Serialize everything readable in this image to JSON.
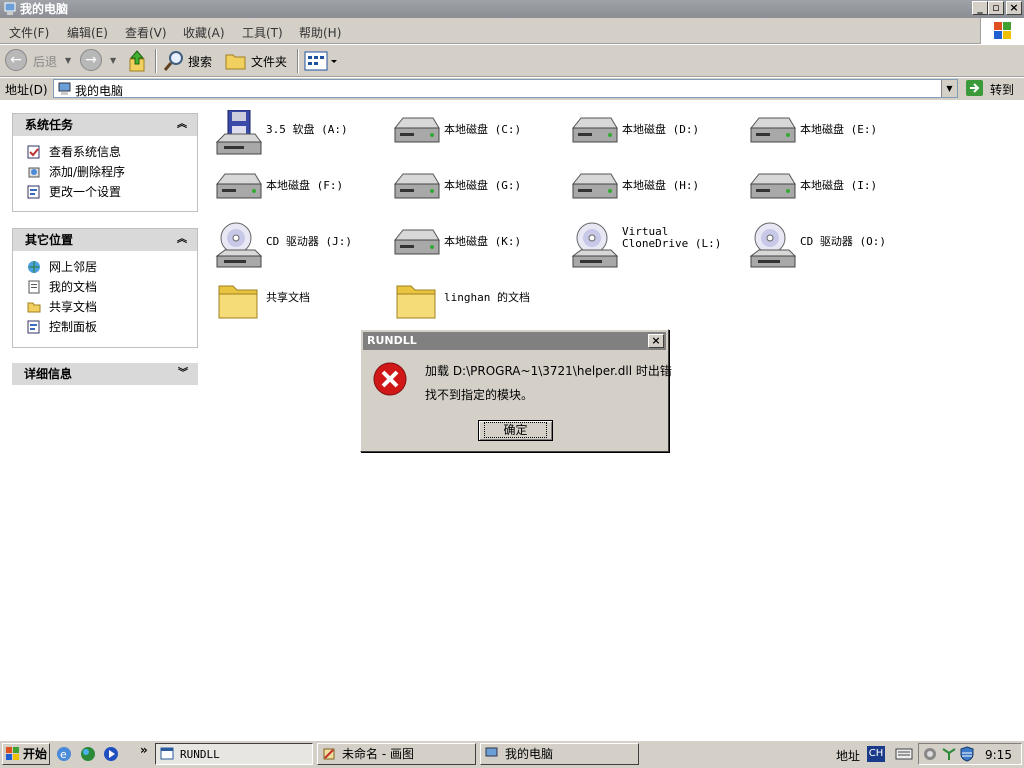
{
  "window": {
    "title": "我的电脑"
  },
  "menu": [
    "文件(F)",
    "编辑(E)",
    "查看(V)",
    "收藏(A)",
    "工具(T)",
    "帮助(H)"
  ],
  "toolbar": {
    "back_label": "后退",
    "search_label": "搜索",
    "folders_label": "文件夹"
  },
  "address": {
    "label": "地址(D)",
    "value": "我的电脑",
    "go_label": "转到"
  },
  "panels": {
    "system_tasks": {
      "title": "系统任务",
      "items": [
        "查看系统信息",
        "添加/删除程序",
        "更改一个设置"
      ]
    },
    "other_places": {
      "title": "其它位置",
      "items": [
        "网上邻居",
        "我的文档",
        "共享文档",
        "控制面板"
      ]
    },
    "details": {
      "title": "详细信息"
    }
  },
  "drives": [
    {
      "label": "3.5 软盘 (A:)",
      "icon": "floppy-icon"
    },
    {
      "label": "本地磁盘 (C:)",
      "icon": "hard-disk-icon"
    },
    {
      "label": "本地磁盘 (D:)",
      "icon": "hard-disk-icon"
    },
    {
      "label": "本地磁盘 (E:)",
      "icon": "hard-disk-icon"
    },
    {
      "label": "本地磁盘 (F:)",
      "icon": "hard-disk-icon"
    },
    {
      "label": "本地磁盘 (G:)",
      "icon": "hard-disk-icon"
    },
    {
      "label": "本地磁盘 (H:)",
      "icon": "hard-disk-icon"
    },
    {
      "label": "本地磁盘 (I:)",
      "icon": "hard-disk-icon"
    },
    {
      "label": "CD 驱动器 (J:)",
      "icon": "cd-drive-icon"
    },
    {
      "label": "本地磁盘 (K:)",
      "icon": "hard-disk-icon"
    },
    {
      "label": "Virtual CloneDrive (L:)",
      "icon": "cd-drive-icon"
    },
    {
      "label": "CD 驱动器 (O:)",
      "icon": "cd-drive-icon"
    },
    {
      "label": "共享文档",
      "icon": "folder-icon"
    },
    {
      "label": "linghan 的文档",
      "icon": "folder-icon"
    }
  ],
  "dialog": {
    "title": "RUNDLL",
    "message_line1": "加载 D:\\PROGRA~1\\3721\\helper.dll 时出错",
    "message_line2": "找不到指定的模块。",
    "ok_label": "确定"
  },
  "taskbar": {
    "start_label": "开始",
    "tasks": [
      "RUNDLL",
      "未命名 - 画图",
      "我的电脑"
    ],
    "address_label": "地址",
    "ime": "CH",
    "clock": "9:15"
  }
}
